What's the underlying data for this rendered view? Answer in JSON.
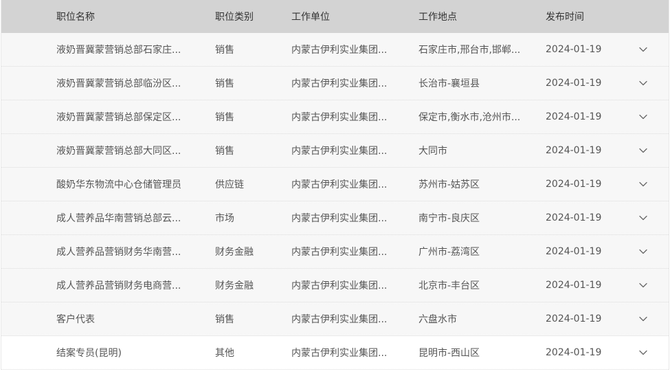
{
  "header": {
    "name": "职位名称",
    "category": "职位类别",
    "unit": "工作单位",
    "location": "工作地点",
    "date": "发布时间"
  },
  "rows": [
    {
      "name": "液奶晋冀蒙营销总部石家庄...",
      "category": "销售",
      "unit": "内蒙古伊利实业集团...",
      "location": "石家庄市,邢台市,邯郸...",
      "date": "2024-01-19"
    },
    {
      "name": "液奶晋冀蒙营销总部临汾区...",
      "category": "销售",
      "unit": "内蒙古伊利实业集团...",
      "location": "长治市-襄垣县",
      "date": "2024-01-19"
    },
    {
      "name": "液奶晋冀蒙营销总部保定区...",
      "category": "销售",
      "unit": "内蒙古伊利实业集团...",
      "location": "保定市,衡水市,沧州市...",
      "date": "2024-01-19"
    },
    {
      "name": "液奶晋冀蒙营销总部大同区...",
      "category": "销售",
      "unit": "内蒙古伊利实业集团...",
      "location": "大同市",
      "date": "2024-01-19"
    },
    {
      "name": "酸奶华东物流中心仓储管理员",
      "category": "供应链",
      "unit": "内蒙古伊利实业集团...",
      "location": "苏州市-姑苏区",
      "date": "2024-01-19"
    },
    {
      "name": "成人营养品华南营销总部云...",
      "category": "市场",
      "unit": "内蒙古伊利实业集团...",
      "location": "南宁市-良庆区",
      "date": "2024-01-19"
    },
    {
      "name": "成人营养品营销财务华南营...",
      "category": "财务金融",
      "unit": "内蒙古伊利实业集团...",
      "location": "广州市-荔湾区",
      "date": "2024-01-19"
    },
    {
      "name": "成人营养品营销财务电商营...",
      "category": "财务金融",
      "unit": "内蒙古伊利实业集团...",
      "location": "北京市-丰台区",
      "date": "2024-01-19"
    },
    {
      "name": "客户代表",
      "category": "销售",
      "unit": "内蒙古伊利实业集团...",
      "location": "六盘水市",
      "date": "2024-01-19"
    },
    {
      "name": "结案专员(昆明)",
      "category": "其他",
      "unit": "内蒙古伊利实业集团...",
      "location": "昆明市-西山区",
      "date": "2024-01-19"
    }
  ],
  "icons": {
    "expand": "chevron-down-icon"
  },
  "colors": {
    "header_bg": "#d3d3d3",
    "row_bg": "#f7f7f7",
    "text": "#555555"
  }
}
